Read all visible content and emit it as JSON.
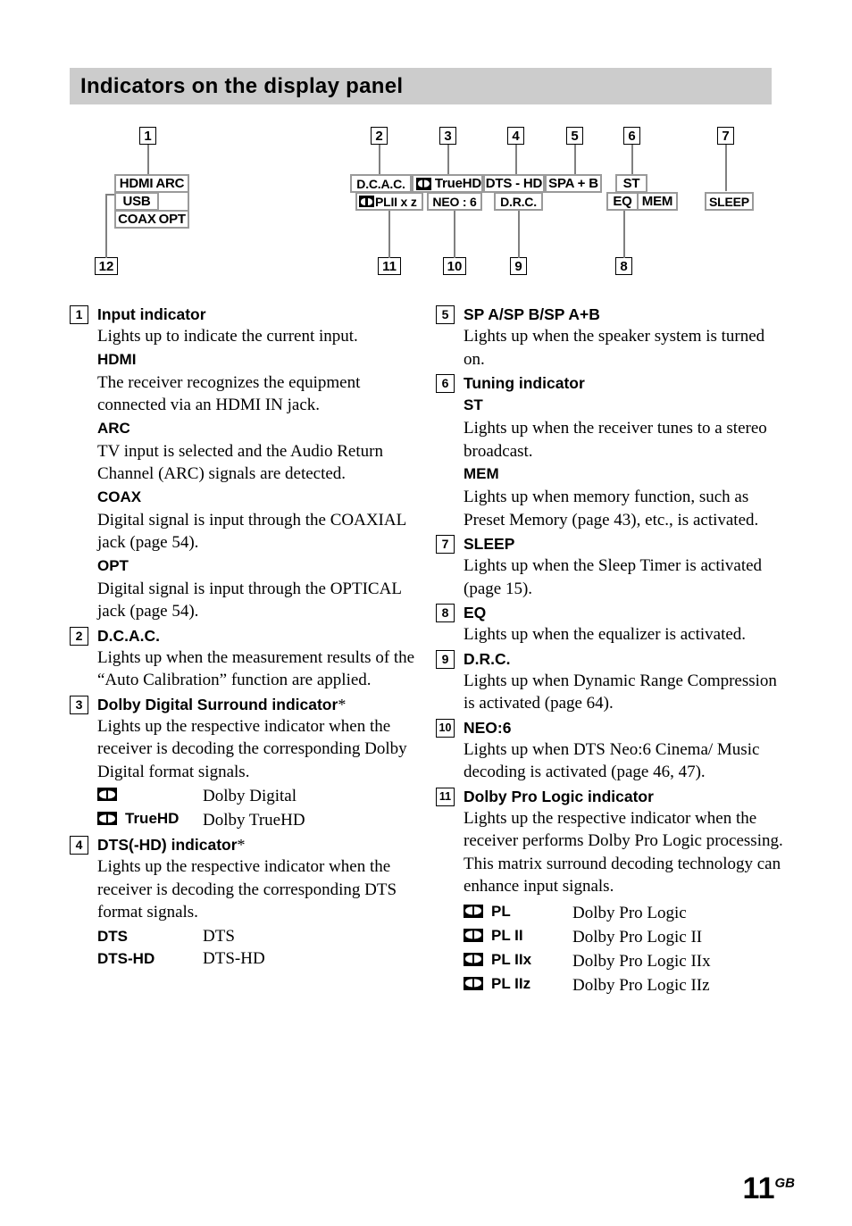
{
  "header": {
    "title": "Indicators on the display panel",
    "background": "#cccccc"
  },
  "diagram": {
    "callouts": [
      "1",
      "2",
      "3",
      "4",
      "5",
      "6",
      "7",
      "8",
      "9",
      "10",
      "11",
      "12"
    ],
    "segments": {
      "hdmi": "HDMI",
      "arc": "ARC",
      "usb": "USB",
      "coax": "COAX",
      "opt": "OPT",
      "dcac": "D.C.A.C.",
      "truehd": "TrueHD",
      "dtshd": "DTS - HD",
      "spab": "SPA + B",
      "st": "ST",
      "eq": "EQ",
      "mem": "MEM",
      "sleep": "SLEEP",
      "plii_xz": "PLII x z",
      "neo6": "NEO : 6",
      "drc": "D.R.C."
    }
  },
  "left_column": [
    {
      "num": "1",
      "title": "Input indicator",
      "body": "Lights up to indicate the current input.",
      "subs": [
        {
          "label": "HDMI",
          "text": "The receiver recognizes the equipment connected via an HDMI IN jack."
        },
        {
          "label": "ARC",
          "text": "TV input is selected and the Audio Return Channel (ARC) signals are detected."
        },
        {
          "label": "COAX",
          "text": "Digital signal is input through the COAXIAL jack (page 54)."
        },
        {
          "label": "OPT",
          "text": "Digital signal is input through the OPTICAL jack (page 54)."
        }
      ]
    },
    {
      "num": "2",
      "title": "D.C.A.C.",
      "body": "Lights up when the measurement results of the “Auto Calibration” function are applied."
    },
    {
      "num": "3",
      "title": "Dolby Digital Surround indicator",
      "star": "*",
      "body": "Lights up the respective indicator when the receiver is decoding the corresponding Dolby Digital format signals.",
      "defs": [
        {
          "glyph": "dolby",
          "key": "",
          "val": "Dolby Digital"
        },
        {
          "glyph": "dolby",
          "key": "TrueHD",
          "val": "Dolby TrueHD"
        }
      ]
    },
    {
      "num": "4",
      "title": "DTS(-HD) indicator",
      "star": "*",
      "body": "Lights up the respective indicator when the receiver is decoding the corresponding DTS format signals.",
      "defs": [
        {
          "glyph": "",
          "key": "DTS",
          "val": "DTS"
        },
        {
          "glyph": "",
          "key": "DTS-HD",
          "val": "DTS-HD"
        }
      ]
    }
  ],
  "right_column": [
    {
      "num": "5",
      "title": "SP A/SP B/SP A+B",
      "body": "Lights up when the speaker system is turned on."
    },
    {
      "num": "6",
      "title": "Tuning indicator",
      "subs": [
        {
          "label": "ST",
          "text": "Lights up when the receiver tunes to a stereo broadcast."
        },
        {
          "label": "MEM",
          "text": "Lights up when memory function, such as Preset Memory (page 43), etc., is activated."
        }
      ]
    },
    {
      "num": "7",
      "title": "SLEEP",
      "body": "Lights up when the Sleep Timer is activated (page 15)."
    },
    {
      "num": "8",
      "title": "EQ",
      "body": "Lights up when the equalizer is activated."
    },
    {
      "num": "9",
      "title": "D.R.C.",
      "body": "Lights up when Dynamic Range Compression is activated (page 64)."
    },
    {
      "num": "10",
      "title": "NEO:6",
      "body": "Lights up when DTS Neo:6 Cinema/ Music decoding is activated (page 46, 47)."
    },
    {
      "num": "11",
      "title": "Dolby Pro Logic indicator",
      "body": "Lights up the respective indicator when the receiver performs Dolby Pro Logic processing. This matrix surround decoding technology can enhance input signals.",
      "defs": [
        {
          "glyph": "dolby",
          "key": "PL",
          "val": "Dolby Pro Logic"
        },
        {
          "glyph": "dolby",
          "key": "PL II",
          "val": "Dolby Pro Logic II"
        },
        {
          "glyph": "dolby",
          "key": "PL IIx",
          "val": "Dolby Pro Logic IIx"
        },
        {
          "glyph": "dolby",
          "key": "PL IIz",
          "val": "Dolby Pro Logic IIz"
        }
      ]
    }
  ],
  "footer": {
    "page": "11",
    "suffix": "GB"
  }
}
